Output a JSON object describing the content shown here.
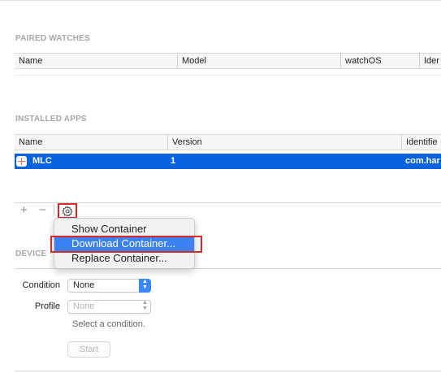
{
  "paired_watches": {
    "title": "PAIRED WATCHES",
    "columns": [
      "Name",
      "Model",
      "watchOS",
      "Ider"
    ]
  },
  "installed_apps": {
    "title": "INSTALLED APPS",
    "columns": [
      "Name",
      "Version",
      "Identifie"
    ],
    "rows": [
      {
        "name": "MLC",
        "version": "1",
        "identifier": "com.har"
      }
    ]
  },
  "toolbar": {
    "add_label": "+",
    "remove_label": "−",
    "gear_icon": "gear-icon"
  },
  "context_menu": {
    "items": [
      "Show Container",
      "Download Container...",
      "Replace Container..."
    ],
    "highlighted": "Download Container..."
  },
  "device_section": {
    "title_partial": "DEVICE"
  },
  "condition": {
    "label": "Condition",
    "value": "None"
  },
  "profile": {
    "label": "Profile",
    "value": "None"
  },
  "hint": "Select a condition.",
  "start_label": "Start",
  "colors": {
    "selection": "#0a63de",
    "menu_highlight": "#3d82f5",
    "annotation_red": "#d42a2a"
  }
}
